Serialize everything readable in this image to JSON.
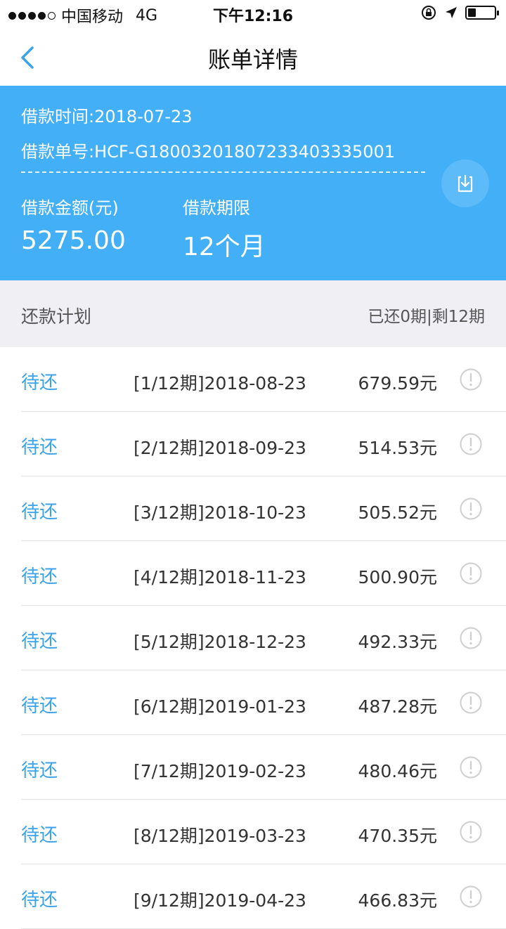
{
  "status_bar": {
    "carrier": "中国移动",
    "network": "4G",
    "time": "下午12:16",
    "battery_level": 0.3
  },
  "nav": {
    "title": "账单详情",
    "back_icon": "chevron-left-icon"
  },
  "loan": {
    "time_text": "借款时间:2018-07-23",
    "number_text": "借款单号:HCF-G1800320180723340333500​1",
    "amount_label": "借款金额(元)",
    "amount_value": "5275.00",
    "term_label": "借款期限",
    "term_value": "12个月",
    "download_icon": "download-icon"
  },
  "plan": {
    "title": "还款计划",
    "status": "已还0期|剩12期"
  },
  "installments": [
    {
      "status": "待还",
      "period": "[1/12期]2018-08-23",
      "amount": "679.59元"
    },
    {
      "status": "待还",
      "period": "[2/12期]2018-09-23",
      "amount": "514.53元"
    },
    {
      "status": "待还",
      "period": "[3/12期]2018-10-23",
      "amount": "505.52元"
    },
    {
      "status": "待还",
      "period": "[4/12期]2018-11-23",
      "amount": "500.90元"
    },
    {
      "status": "待还",
      "period": "[5/12期]2018-12-23",
      "amount": "492.33元"
    },
    {
      "status": "待还",
      "period": "[6/12期]2019-01-23",
      "amount": "487.28元"
    },
    {
      "status": "待还",
      "period": "[7/12期]2019-02-23",
      "amount": "480.46元"
    },
    {
      "status": "待还",
      "period": "[8/12期]2019-03-23",
      "amount": "470.35元"
    },
    {
      "status": "待还",
      "period": "[9/12期]2019-04-23",
      "amount": "466.83元"
    }
  ],
  "colors": {
    "brand_blue": "#43aff7",
    "status_blue": "#3aa3ec"
  }
}
